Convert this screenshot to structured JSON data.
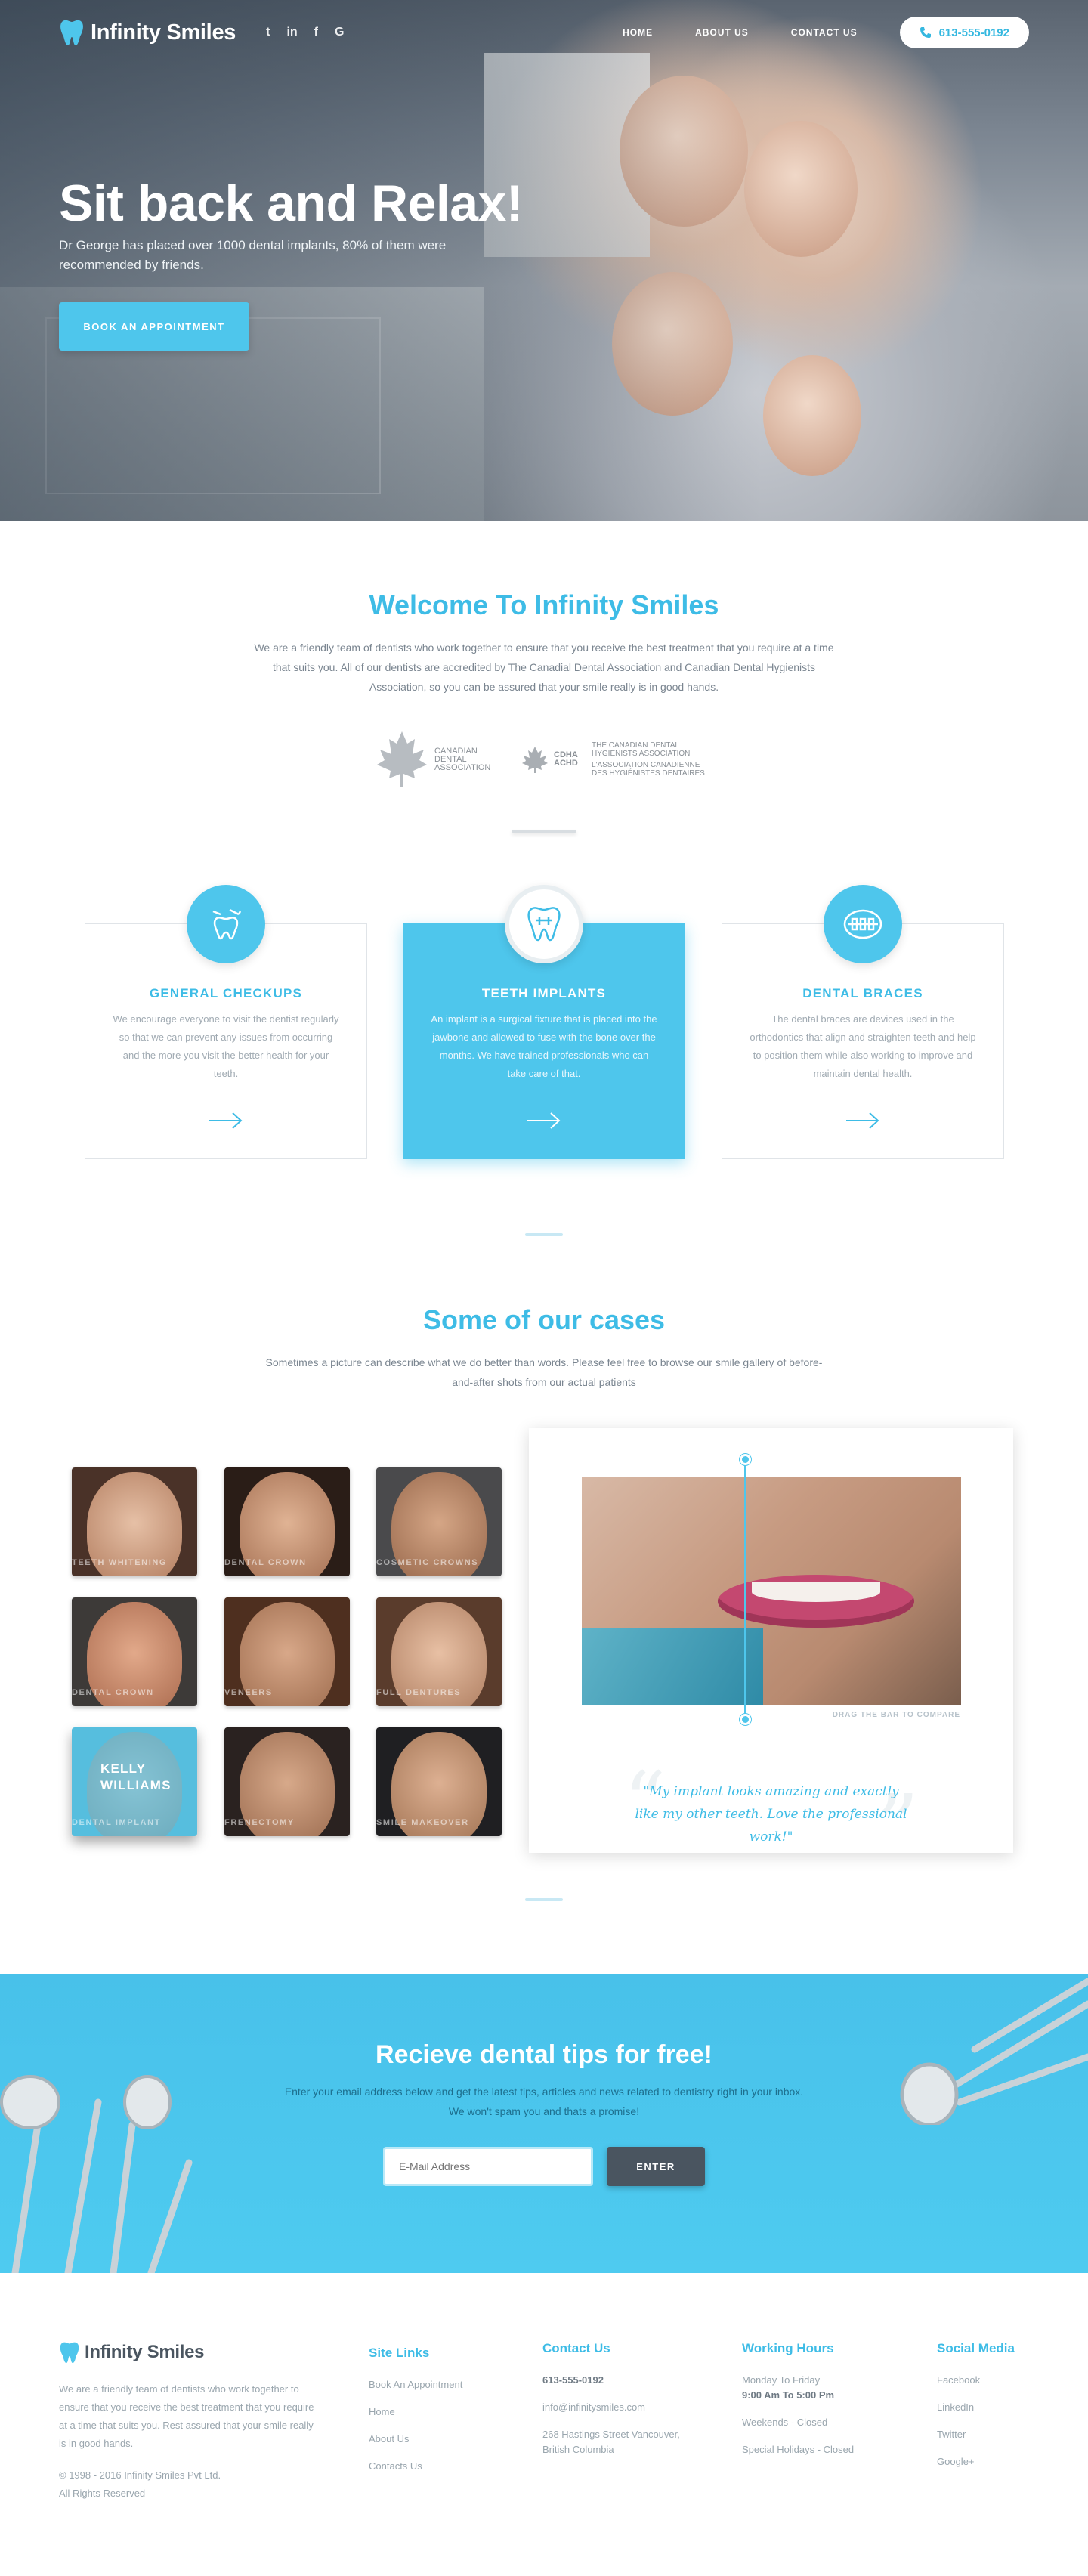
{
  "brand": {
    "name": "Infinity Smiles"
  },
  "header": {
    "socials": [
      "twitter-icon",
      "linkedin-icon",
      "facebook-icon",
      "google-plus-icon"
    ],
    "nav": [
      "HOME",
      "ABOUT US",
      "CONTACT US"
    ],
    "phone": "613-555-0192"
  },
  "hero": {
    "title": "Sit back and Relax!",
    "subtitle": "Dr George has placed over 1000 dental implants, 80% of them were recommended by friends.",
    "cta": "BOOK  AN  APPOINTMENT"
  },
  "welcome": {
    "title": "Welcome To Infinity Smiles",
    "text": "We are a friendly team of dentists who work together to ensure that you receive the best treatment that you require at a time that suits you. All of our dentists are accredited by The Canadial Dental Association and  Canadian Dental Hygienists Association, so you can be assured that your smile really is in good hands.",
    "assoc1": "CANADIAN DENTAL ASSOCIATION",
    "assoc2_a": "THE CANADIAN DENTAL HYGIENISTS ASSOCIATION",
    "assoc2_b": "L'ASSOCIATION CANADIENNE DES HYGIÉNISTES DENTAIRES",
    "assoc2_abbr": "CDHA ACHD"
  },
  "services": [
    {
      "title": "GENERAL CHECKUPS",
      "text": "We encourage everyone to visit the dentist regularly so that we can prevent any  issues from occurring and the more you visit the better health for your teeth."
    },
    {
      "title": "TEETH IMPLANTS",
      "text": "An implant is a surgical fixture that is placed into the jawbone and allowed to fuse with the bone over the months. We have trained professionals who can take care of that."
    },
    {
      "title": "DENTAL BRACES",
      "text": "The dental braces are devices used in the orthodontics that align and straighten teeth and help to position them while also working to improve and maintain dental health."
    }
  ],
  "cases": {
    "title": "Some of our cases",
    "text": "Sometimes a picture can describe what we do better than words. Please feel free to browse our smile gallery of before-and-after shots from our actual patients",
    "thumbs": [
      "TEETH WHITENING",
      "DENTAL CROWN",
      "COSMETIC CROWNS",
      "DENTAL CROWN",
      "VENEERS",
      "FULL DENTURES",
      "DENTAL IMPLANT",
      "FRENECTOMY",
      "SMILE MAKEOVER"
    ],
    "selected_name": "KELLY WILLIAMS",
    "drag_hint": "DRAG THE BAR TO COMPARE",
    "compare_position": 0.43,
    "quote": "\"My implant looks amazing and exactly like my other teeth. Love the professional work!\""
  },
  "newsletter": {
    "title": "Recieve dental tips for free!",
    "text": "Enter your email address below and get the latest tips, articles and news related to dentistry right in your inbox. We won't spam you and thats a promise!",
    "placeholder": "E-Mail Address",
    "button": "ENTER"
  },
  "footer": {
    "about": "We are a friendly team of dentists who work together to ensure that you receive the best treatment that you require at a time that suits you. Rest assured that your smile really is in good hands.",
    "copyright1": "© 1998 - 2016 Infinity Smiles Pvt Ltd.",
    "copyright2": "All Rights Reserved",
    "site_links": {
      "title": "Site Links",
      "items": [
        "Book An Appointment",
        "Home",
        "About Us",
        "Contacts Us"
      ]
    },
    "contact": {
      "title": "Contact Us",
      "phone": "613-555-0192",
      "email": "info@infinitysmiles.com",
      "address": "268 Hastings Street Vancouver, British Columbia"
    },
    "hours": {
      "title": "Working Hours",
      "line1": "Monday To Friday",
      "line2": "9:00 Am To 5:00 Pm",
      "line3": "Weekends - Closed",
      "line4": "Special Holidays - Closed"
    },
    "social": {
      "title": "Social Media",
      "items": [
        "Facebook",
        "LinkedIn",
        "Twitter",
        "Google+"
      ]
    }
  },
  "colors": {
    "accent": "#4ec6ec",
    "accent_text": "#3ebce6",
    "dark": "#4a5560"
  }
}
